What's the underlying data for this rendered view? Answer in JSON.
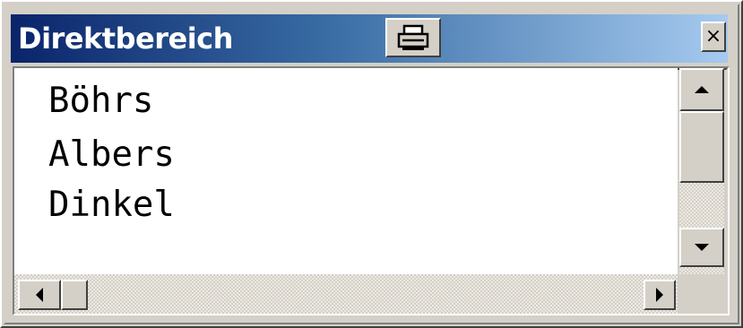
{
  "window": {
    "title": "Direktbereich",
    "close_glyph": "×",
    "print_icon": "printer-icon"
  },
  "content": {
    "lines": [
      "Böhrs",
      "Albers",
      "Dinkel"
    ]
  },
  "scrollbars": {
    "vertical": {
      "up_icon": "arrow-up-icon",
      "down_icon": "arrow-down-icon"
    },
    "horizontal": {
      "left_icon": "arrow-left-icon",
      "right_icon": "arrow-right-icon"
    }
  },
  "colors": {
    "titlebar_start": "#0a246a",
    "titlebar_end": "#a6caf0",
    "face": "#d4d0c8",
    "text_bg": "#ffffff"
  }
}
